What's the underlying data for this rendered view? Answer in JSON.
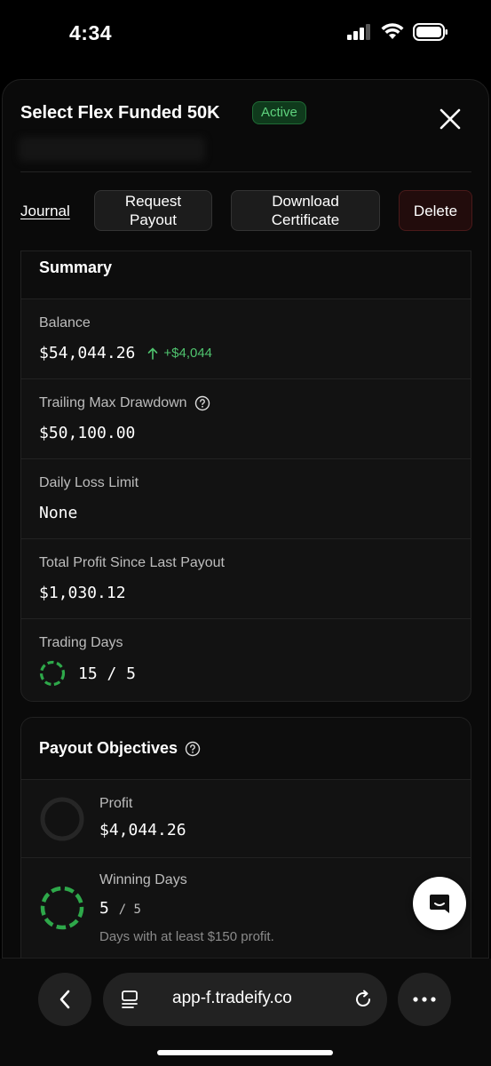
{
  "status": {
    "time": "4:34"
  },
  "sheet": {
    "title": "Select Flex Funded 50K",
    "badge": "Active",
    "actions": {
      "journal": "Journal",
      "request_payout": "Request Payout",
      "download_certificate": "Download Certificate",
      "delete": "Delete"
    }
  },
  "summary": {
    "title": "Summary",
    "balance_label": "Balance",
    "balance_value": "$54,044.26",
    "balance_delta": "+$4,044",
    "drawdown_label": "Trailing Max Drawdown",
    "drawdown_value": "$50,100.00",
    "daily_loss_label": "Daily Loss Limit",
    "daily_loss_value": "None",
    "profit_label": "Total Profit Since Last Payout",
    "profit_value": "$1,030.12",
    "trading_days_label": "Trading Days",
    "trading_days_value": "15 / 5"
  },
  "payout": {
    "title": "Payout Objectives",
    "profit_label": "Profit",
    "profit_value": "$4,044.26",
    "profit_progress": 0,
    "winning_days_label": "Winning Days",
    "winning_days_current": "5",
    "winning_days_target": "/ 5",
    "winning_days_progress": 1,
    "winning_days_desc": "Days with at least $150 profit."
  },
  "browser": {
    "url": "app-f.tradeify.co"
  },
  "colors": {
    "accent_green": "#4fc36e",
    "badge_bg": "#0f3a1c",
    "delete_bg": "#220c0c"
  }
}
